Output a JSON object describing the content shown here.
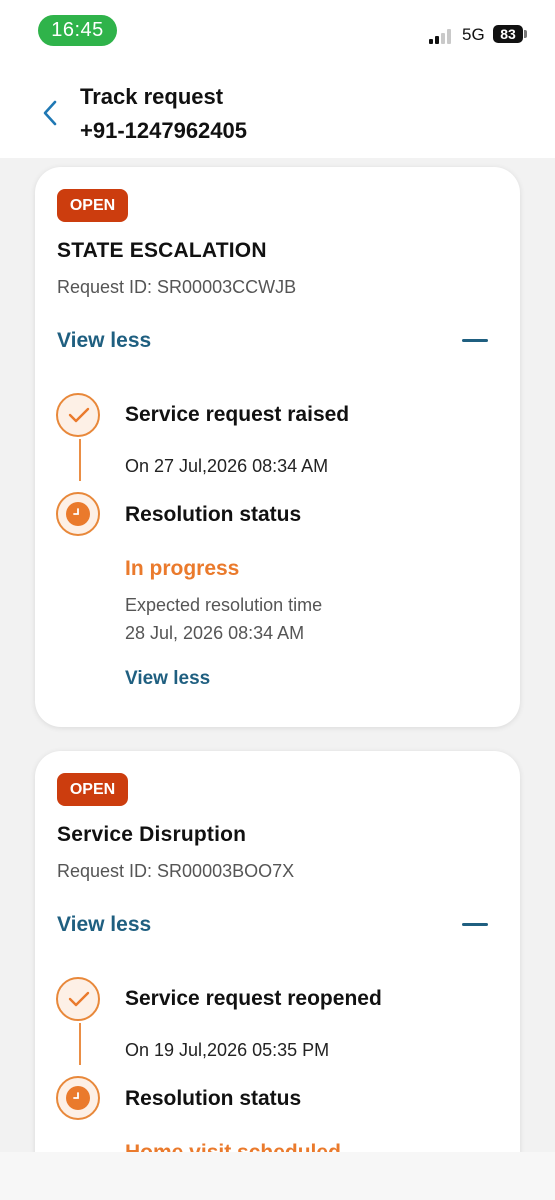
{
  "status_bar": {
    "time": "16:45",
    "network": "5G",
    "battery": "83",
    "icons": [
      "signal-icon",
      "battery-icon"
    ]
  },
  "header": {
    "title": "Track request",
    "subtitle": "+91-1247962405",
    "back_icon": "chevron-left-icon"
  },
  "colors": {
    "accent_blue": "#1f5f80",
    "badge_red": "#cc3d0e",
    "orange": "#ea7a2c",
    "status_green": "#2fb34a"
  },
  "requests": [
    {
      "badge": "OPEN",
      "title": "STATE ESCALATION",
      "request_id": "Request ID: SR00003CCWJB",
      "toggle_label": "View less",
      "steps": {
        "raised_title": "Service request raised",
        "raised_date": "On 27 Jul,2026 08:34 AM",
        "resolution_title": "Resolution status",
        "status": "In progress",
        "expected_label": "Expected resolution time",
        "expected_time": "28 Jul, 2026 08:34 AM",
        "inner_toggle": "View less"
      }
    },
    {
      "badge": "OPEN",
      "title": "Service Disruption",
      "request_id": "Request ID: SR00003BOO7X",
      "toggle_label": "View less",
      "steps": {
        "raised_title": "Service request reopened",
        "raised_date": "On 19 Jul,2026 05:35 PM",
        "resolution_title": "Resolution status",
        "status": "Home visit scheduled"
      }
    }
  ]
}
